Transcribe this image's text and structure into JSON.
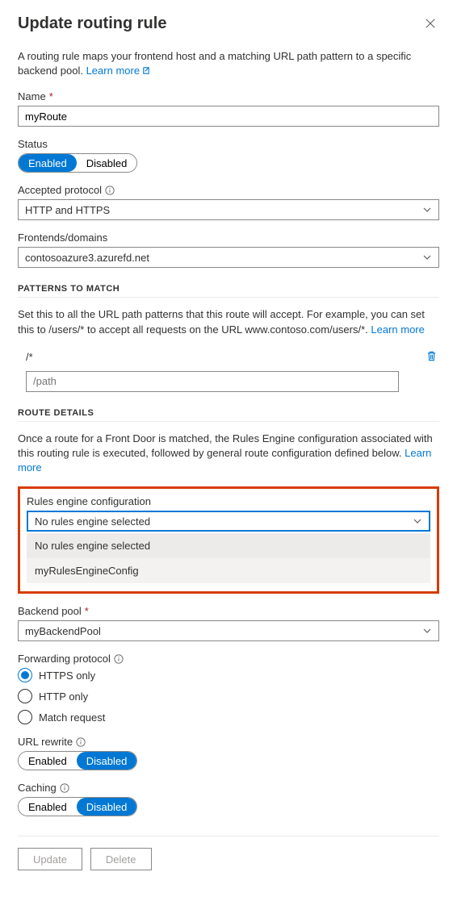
{
  "header": {
    "title": "Update routing rule"
  },
  "intro": {
    "text": "A routing rule maps your frontend host and a matching URL path pattern to a specific backend pool. ",
    "learn_more": "Learn more"
  },
  "name": {
    "label": "Name",
    "value": "myRoute"
  },
  "status": {
    "label": "Status",
    "enabled": "Enabled",
    "disabled": "Disabled"
  },
  "accepted_protocol": {
    "label": "Accepted protocol",
    "value": "HTTP and HTTPS"
  },
  "frontends": {
    "label": "Frontends/domains",
    "value": "contosoazure3.azurefd.net"
  },
  "patterns": {
    "heading": "PATTERNS TO MATCH",
    "desc": "Set this to all the URL path patterns that this route will accept. For example, you can set this to /users/* to accept all requests on the URL www.contoso.com/users/*. ",
    "learn_more": "Learn more",
    "rows": [
      "/*"
    ],
    "placeholder": "/path"
  },
  "route_details": {
    "heading": "ROUTE DETAILS",
    "desc": "Once a route for a Front Door is matched, the Rules Engine configuration associated with this routing rule is executed, followed by general route configuration defined below. ",
    "learn_more": "Learn more"
  },
  "rules_engine": {
    "label": "Rules engine configuration",
    "value": "No rules engine selected",
    "options": [
      "No rules engine selected",
      "myRulesEngineConfig"
    ]
  },
  "backend_pool": {
    "label": "Backend pool",
    "value": "myBackendPool"
  },
  "forwarding_protocol": {
    "label": "Forwarding protocol",
    "options": [
      "HTTPS only",
      "HTTP only",
      "Match request"
    ],
    "selected": "HTTPS only"
  },
  "url_rewrite": {
    "label": "URL rewrite",
    "enabled": "Enabled",
    "disabled": "Disabled"
  },
  "caching": {
    "label": "Caching",
    "enabled": "Enabled",
    "disabled": "Disabled"
  },
  "footer": {
    "update": "Update",
    "delete": "Delete"
  }
}
